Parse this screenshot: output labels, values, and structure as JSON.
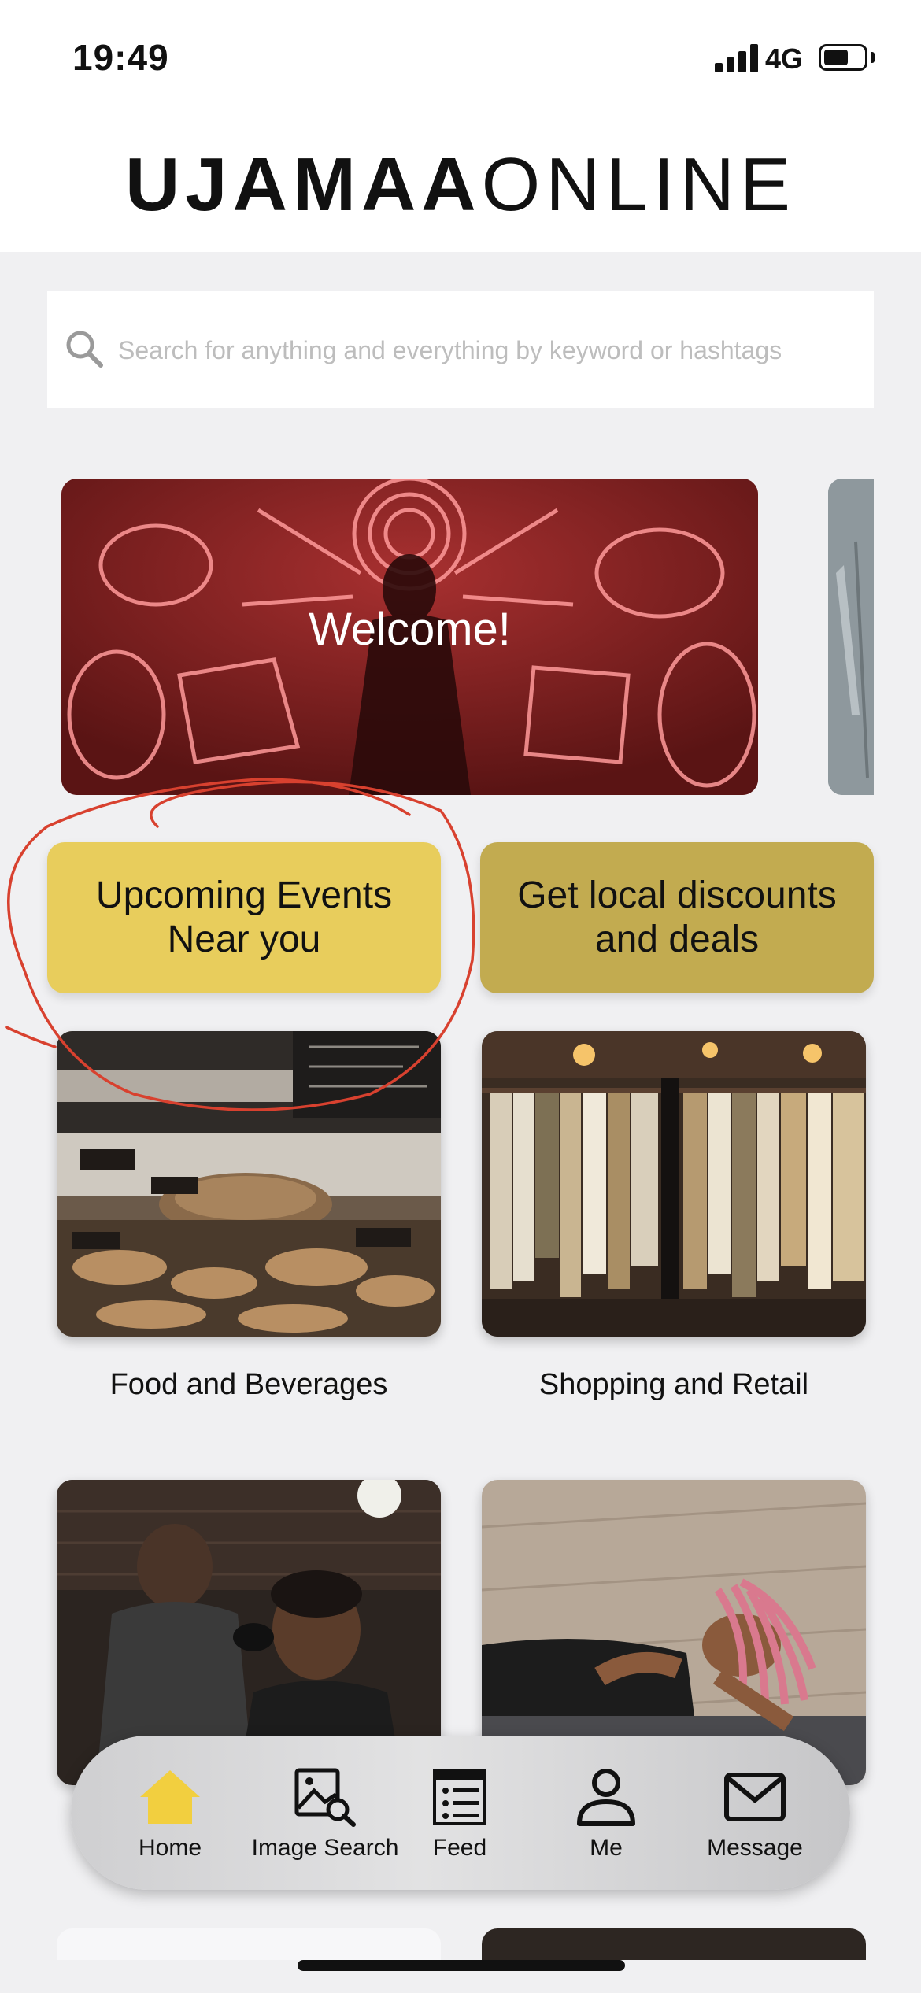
{
  "status_bar": {
    "time": "19:49",
    "network": "4G"
  },
  "header": {
    "logo_bold": "UJAMAA",
    "logo_light": "ONLINE"
  },
  "search": {
    "placeholder": "Search for anything and everything by keyword or hashtags",
    "value": ""
  },
  "banner": {
    "title": "Welcome!"
  },
  "actions": {
    "events_line1": "Upcoming Events",
    "events_line2": "Near you",
    "deals_line1": "Get local discounts",
    "deals_line2": "and deals"
  },
  "categories": [
    {
      "label": "Food and Beverages"
    },
    {
      "label": "Shopping and Retail"
    },
    {
      "label": ""
    },
    {
      "label": ""
    }
  ],
  "nav": {
    "items": [
      {
        "label": "Home",
        "icon": "home-icon"
      },
      {
        "label": "Image Search",
        "icon": "image-search-icon"
      },
      {
        "label": "Feed",
        "icon": "feed-icon"
      },
      {
        "label": "Me",
        "icon": "person-icon"
      },
      {
        "label": "Message",
        "icon": "mail-icon"
      }
    ]
  },
  "colors": {
    "events_button": "#e8cd5c",
    "deals_button": "#c2ab50",
    "home_icon_active": "#f2cf3f",
    "annotation_stroke": "#d8412f"
  }
}
